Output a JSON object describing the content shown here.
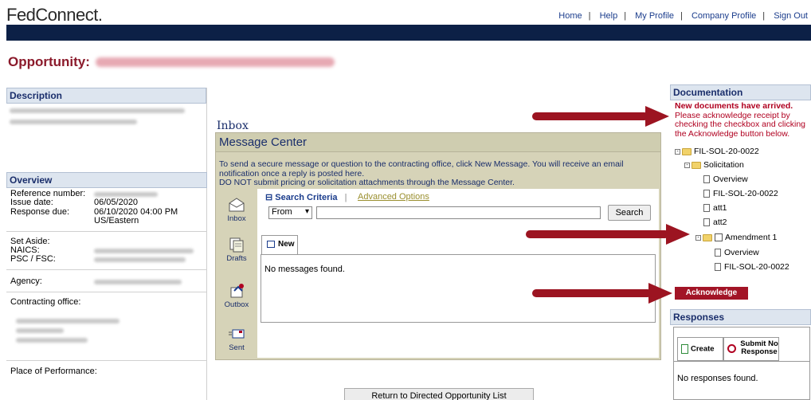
{
  "header": {
    "logo": "FedConnect.",
    "nav": [
      "Home",
      "Help",
      "My Profile",
      "Company Profile",
      "Sign Out"
    ]
  },
  "opportunity": {
    "label": "Opportunity:"
  },
  "description": {
    "title": "Description"
  },
  "overview": {
    "title": "Overview",
    "reference_label": "Reference number:",
    "issue_label": "Issue date:",
    "issue_value": "06/05/2020",
    "response_label": "Response due:",
    "response_value": "06/10/2020 04:00 PM",
    "response_tz": "US/Eastern",
    "setaside_label": "Set Aside:",
    "naics_label": "NAICS:",
    "psc_label": "PSC / FSC:",
    "agency_label": "Agency:",
    "contracting_label": "Contracting office:",
    "place_label": "Place of Performance:"
  },
  "inbox": {
    "label": "Inbox",
    "title": "Message Center",
    "intro_line1": "To send a secure message or question to the contracting office, click New Message. You will receive an email",
    "intro_line2": "notification once a reply is posted here.",
    "intro_line3": "DO NOT submit pricing or solicitation attachments through the Message Center.",
    "side": [
      "Inbox",
      "Drafts",
      "Outbox",
      "Sent"
    ],
    "search_criteria": "Search Criteria",
    "advanced_options": "Advanced Options",
    "from_value": "From",
    "search_button": "Search",
    "tab_new": "New",
    "no_messages": "No messages found.",
    "return_button": "Return to Directed Opportunity List"
  },
  "documentation": {
    "title": "Documentation",
    "alert_bold": "New documents have arrived.",
    "alert_text": "Please acknowledge receipt by checking the checkbox and clicking the Acknowledge button below.",
    "tree": {
      "root": "FIL-SOL-20-0022",
      "solicitation": "Solicitation",
      "overview": "Overview",
      "file1": "FIL-SOL-20-0022",
      "att1": "att1",
      "att2": "att2",
      "amendment": "Amendment 1",
      "am_overview": "Overview",
      "am_file": "FIL-SOL-20-0022"
    },
    "acknowledge": "Acknowledge"
  },
  "responses": {
    "title": "Responses",
    "create": "Create",
    "submit_no_1": "Submit No",
    "submit_no_2": "Response",
    "none": "No responses found."
  },
  "colors": {
    "navbar": "#0c2046",
    "accent_red": "#9c1421",
    "section_head": "#dde5ef",
    "message_center": "#d6d3b8"
  }
}
